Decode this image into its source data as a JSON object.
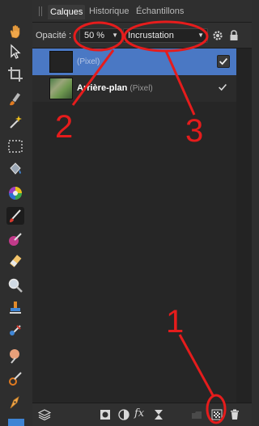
{
  "tabs": [
    {
      "label": "Calques",
      "active": true
    },
    {
      "label": "Historique",
      "active": false
    },
    {
      "label": "Échantillons",
      "active": false
    }
  ],
  "controls": {
    "opacity_label": "Opacité :",
    "opacity_value": "50 %",
    "blend_mode": "Incrustation"
  },
  "layers": [
    {
      "name": "",
      "type": "(Pixel)",
      "selected": true,
      "visible": true
    },
    {
      "name": "Arrière-plan",
      "type": "(Pixel)",
      "selected": false,
      "visible": true
    }
  ],
  "annotations": [
    "1",
    "2",
    "3"
  ],
  "colors": {
    "selection": "#4a78c4",
    "annotation": "#e51c1c",
    "panel": "#262626"
  },
  "icons": {
    "toolbar": [
      "hand-icon",
      "move-pointer-icon",
      "crop-icon",
      "brush-icon",
      "magic-wand-icon",
      "marquee-icon",
      "fill-bucket-icon",
      "color-wheel-icon",
      "paint-brush-icon",
      "color-replace-brush-icon",
      "eraser-icon",
      "zoom-icon",
      "stamp-icon",
      "healing-brush-icon",
      "dodge-icon",
      "smudge-icon",
      "pen-icon"
    ],
    "bottom": [
      "layers-stack-icon",
      "mask-icon",
      "adjustment-icon",
      "fx-icon",
      "hourglass-icon",
      "group-icon",
      "add-pixel-layer-icon",
      "trash-icon"
    ]
  }
}
